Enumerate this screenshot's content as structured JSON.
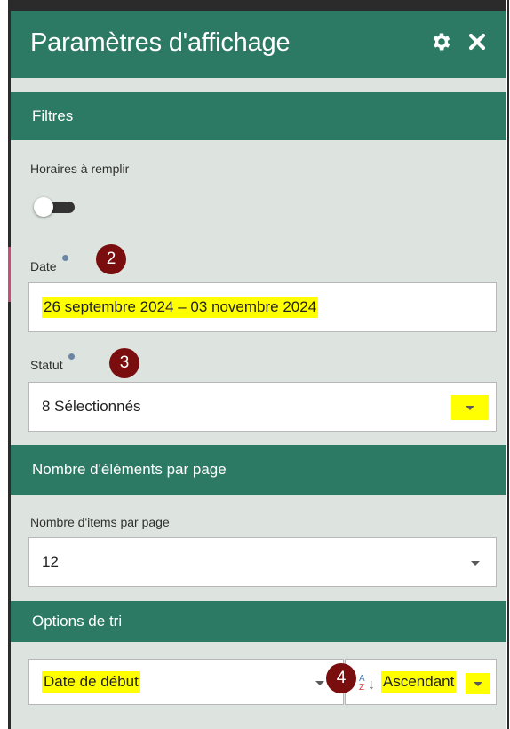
{
  "header": {
    "title": "Paramètres d'affichage",
    "icons": [
      "gear-icon",
      "close-icon"
    ]
  },
  "filters": {
    "section_title": "Filtres",
    "horaires_label": "Horaires à remplir",
    "horaires_toggle": "off",
    "date_label": "Date",
    "date_value": "26 septembre 2024 – 03 novembre 2024",
    "statut_label": "Statut",
    "statut_value": "8 Sélectionnés"
  },
  "pagination": {
    "section_title": "Nombre d'éléments par page",
    "items_label": "Nombre d'items par page",
    "items_value": "12"
  },
  "sort": {
    "section_title": "Options de tri",
    "field_value": "Date de début",
    "order_value": "Ascendant"
  },
  "annotations": {
    "badge_2": "2",
    "badge_3": "3",
    "badge_4": "4"
  },
  "colors": {
    "header_bg": "#2c7a64",
    "panel_bg": "#dde4e0",
    "highlight": "#ffff00",
    "badge_bg": "#7a0e0e"
  }
}
